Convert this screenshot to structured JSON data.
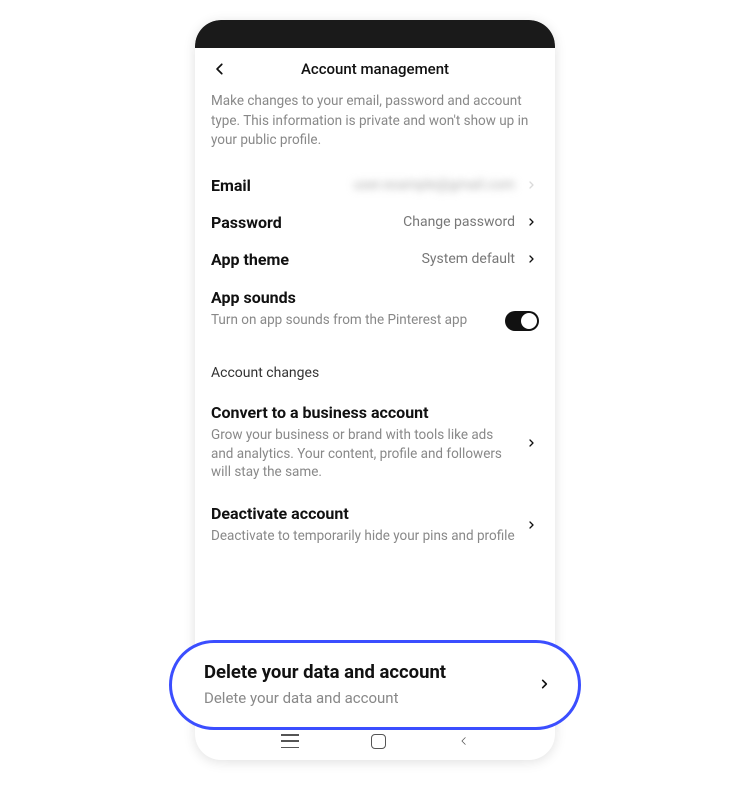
{
  "header": {
    "title": "Account management"
  },
  "description": "Make changes to your email, password and account type. This information is private and won't show up in your public profile.",
  "settings": {
    "email": {
      "label": "Email",
      "value": "user.example@gmail.com"
    },
    "password": {
      "label": "Password",
      "value": "Change password"
    },
    "theme": {
      "label": "App theme",
      "value": "System default"
    },
    "sounds": {
      "label": "App sounds",
      "description": "Turn on app sounds from the Pinterest app",
      "enabled": true
    }
  },
  "section_header": "Account changes",
  "items": {
    "convert": {
      "title": "Convert to a business account",
      "desc": "Grow your business or brand with tools like ads and analytics. Your content, profile and followers will stay the same."
    },
    "deactivate": {
      "title": "Deactivate account",
      "desc": "Deactivate to temporarily hide your pins and profile"
    },
    "delete": {
      "title": "Delete your data and account",
      "desc": "Delete your data and account"
    }
  }
}
